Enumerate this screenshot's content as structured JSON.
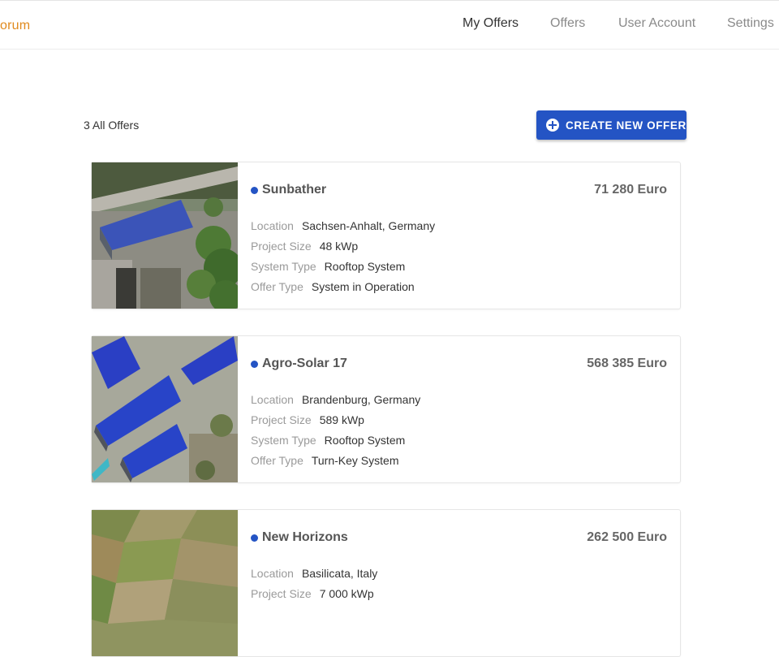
{
  "header": {
    "brand": "orum",
    "nav": [
      {
        "label": "My Offers",
        "active": true
      },
      {
        "label": "Offers",
        "active": false
      },
      {
        "label": "User Account",
        "active": false
      },
      {
        "label": "Settings",
        "active": false
      }
    ]
  },
  "toolbar": {
    "count_text": "3 All Offers",
    "create_label": "CREATE NEW OFFER",
    "create_icon": "plus-circle-icon"
  },
  "colors": {
    "accent": "#2454c4",
    "brand": "#e08a1e"
  },
  "offers": [
    {
      "name": "Sunbather",
      "price": "71 280 Euro",
      "status_color": "#2454c4",
      "details": [
        {
          "label": "Location",
          "value": "Sachsen-Anhalt, Germany"
        },
        {
          "label": "Project Size",
          "value": "48 kWp"
        },
        {
          "label": "System Type",
          "value": "Rooftop System"
        },
        {
          "label": "Offer Type",
          "value": "System in Operation"
        }
      ]
    },
    {
      "name": "Agro-Solar 17",
      "price": "568 385 Euro",
      "status_color": "#2454c4",
      "details": [
        {
          "label": "Location",
          "value": "Brandenburg, Germany"
        },
        {
          "label": "Project Size",
          "value": "589 kWp"
        },
        {
          "label": "System Type",
          "value": "Rooftop System"
        },
        {
          "label": "Offer Type",
          "value": "Turn-Key System"
        }
      ]
    },
    {
      "name": "New Horizons",
      "price": "262 500 Euro",
      "status_color": "#2454c4",
      "details": [
        {
          "label": "Location",
          "value": "Basilicata, Italy"
        },
        {
          "label": "Project Size",
          "value": "7 000 kWp"
        }
      ]
    }
  ]
}
